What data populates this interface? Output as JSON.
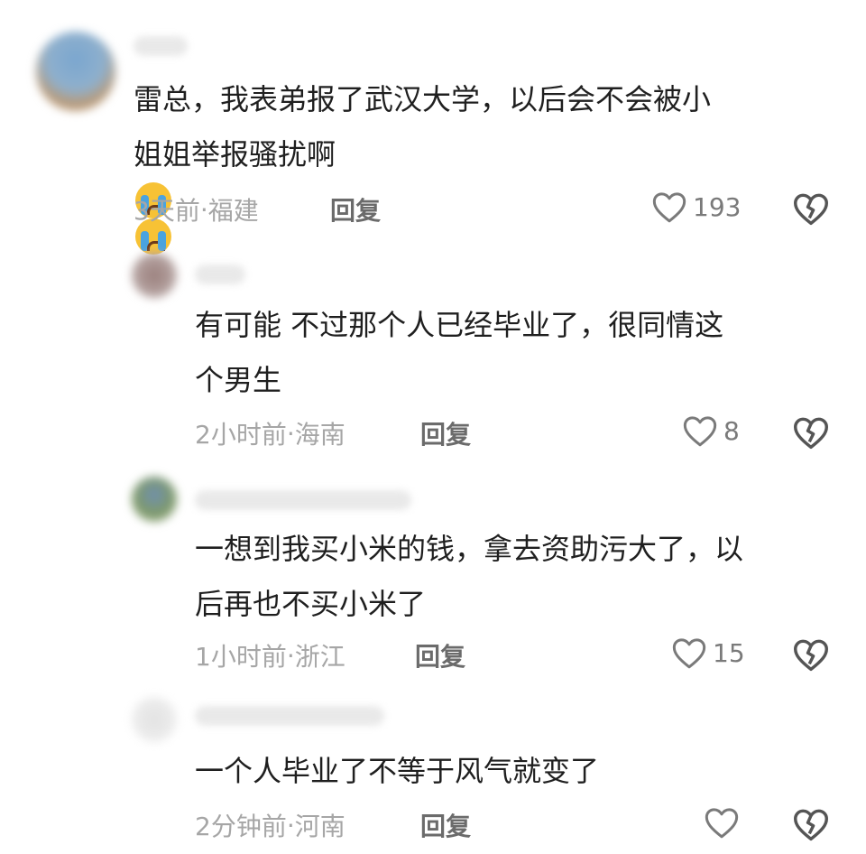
{
  "comments": [
    {
      "lines": [
        "雷总，我表弟报了武汉大学，以后会不会被小",
        "姐姐举报骚扰啊"
      ],
      "emoji": [
        "loudly-crying-face",
        "loudly-crying-face"
      ],
      "time": "3天前",
      "location": "福建",
      "reply_label": "回复",
      "likes": "193"
    },
    {
      "lines": [
        "有可能 不过那个人已经毕业了，很同情这",
        "个男生"
      ],
      "time": "2小时前",
      "location": "海南",
      "reply_label": "回复",
      "likes": "8"
    },
    {
      "lines": [
        "一想到我买小米的钱，拿去资助污大了，以",
        "后再也不买小米了"
      ],
      "time": "1小时前",
      "location": "浙江",
      "reply_label": "回复",
      "likes": "15"
    },
    {
      "lines": [
        "一个人毕业了不等于风气就变了"
      ],
      "time": "2分钟前",
      "location": "河南",
      "reply_label": "回复",
      "likes": ""
    }
  ],
  "separator": " · ",
  "icons": {
    "like": "heart-outline-icon",
    "dislike": "broken-heart-outline-icon"
  }
}
